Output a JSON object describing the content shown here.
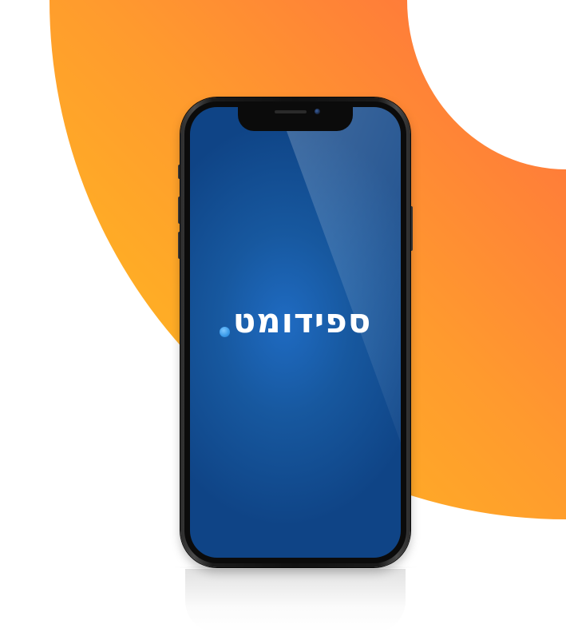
{
  "background": {
    "shape_icon": "orange-arc-icon",
    "gradient_colors": [
      "#ff7a3a",
      "#ffa62a",
      "#ffc01e"
    ],
    "page_color": "#ffffff"
  },
  "device": {
    "type": "smartphone",
    "frame_color": "#1a1a1a",
    "screen": {
      "background_color": "#1a5cab",
      "logo": {
        "text": "ספידומט",
        "text_color": "#ffffff",
        "dot_icon": "blue-dot-icon",
        "dot_color": "#3a9ae8"
      }
    }
  }
}
